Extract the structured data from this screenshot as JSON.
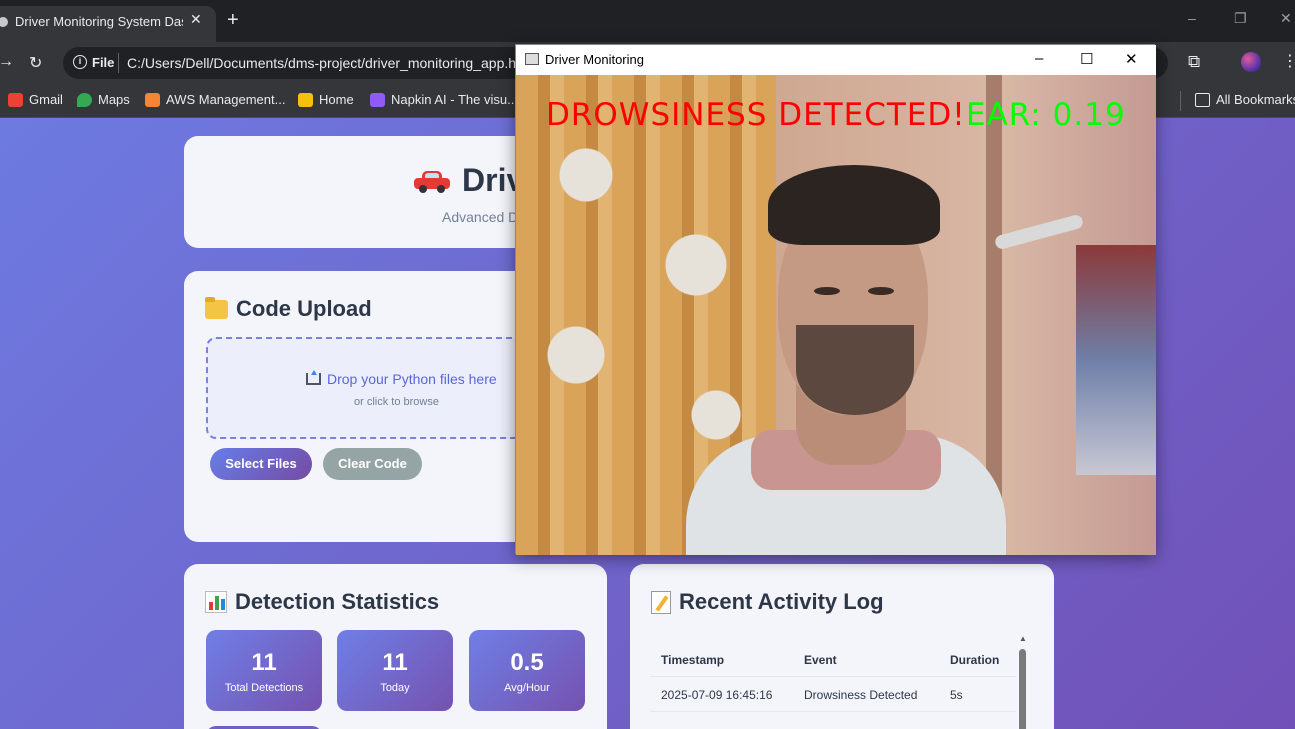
{
  "browser": {
    "tab_title": "Driver Monitoring System Dashb",
    "tab_close": "✕",
    "new_tab": "+",
    "window_controls": [
      "–",
      "❐",
      "✕"
    ],
    "address": {
      "scheme_label": "File",
      "url": "C:/Users/Dell/Documents/dms-project/driver_monitoring_app.h"
    },
    "bookmarks": [
      {
        "label": "Gmail",
        "icon": "gmail-icon",
        "color": "#ea4335"
      },
      {
        "label": "Maps",
        "icon": "maps-icon",
        "color": "#34a853"
      },
      {
        "label": "AWS Management...",
        "icon": "aws-icon",
        "color": "#f58536"
      },
      {
        "label": "Home",
        "icon": "home-icon",
        "color": "#f4c20d"
      },
      {
        "label": "Napkin AI - The visu...",
        "icon": "napkin-icon",
        "color": "#8e5cf5"
      }
    ],
    "all_bookmarks": "All Bookmarks"
  },
  "header": {
    "title": "Driv",
    "subtitle": "Advanced D"
  },
  "upload": {
    "title": "Code Upload",
    "drop_text": "Drop your Python files here",
    "drop_hint": "or click to browse",
    "select_button": "Select Files",
    "clear_button": "Clear Code"
  },
  "stats": {
    "title": "Detection Statistics",
    "items": [
      {
        "value": "11",
        "label": "Total Detections"
      },
      {
        "value": "11",
        "label": "Today"
      },
      {
        "value": "0.5",
        "label": "Avg/Hour"
      }
    ]
  },
  "activity_log": {
    "title": "Recent Activity Log",
    "columns": [
      "Timestamp",
      "Event",
      "Duration"
    ],
    "rows": [
      {
        "timestamp": "2025-07-09 16:45:16",
        "event": "Drowsiness Detected",
        "duration": "5s"
      }
    ]
  },
  "monitor_window": {
    "title": "Driver Monitoring",
    "alert_text": "DROWSINESS DETECTED!",
    "ear_text": "EAR: 0.19",
    "alert_color": "#ff0000",
    "ear_color": "#00ff00"
  },
  "colors": {
    "page_gradient_start": "#6d7ae0",
    "page_gradient_end": "#7151b8",
    "accent": "#5a67d8",
    "clear_button": "#95a5a6"
  }
}
